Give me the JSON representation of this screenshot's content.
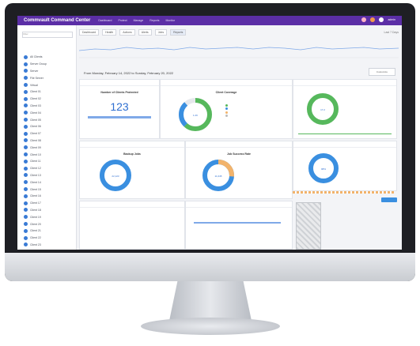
{
  "app": {
    "brand": "Commvault Command Center",
    "nav": [
      "Dashboard",
      "Protect",
      "Manage",
      "Reports",
      "Monitor"
    ],
    "user_label": "admin"
  },
  "sidebar": {
    "search_placeholder": "Filter",
    "items": [
      "All Clients",
      "Server Group",
      "Server",
      "File Server",
      "Virtual",
      "Client 01",
      "Client 02",
      "Client 03",
      "Client 04",
      "Client 05",
      "Client 06",
      "Client 07",
      "Client 08",
      "Client 09",
      "Client 10",
      "Client 11",
      "Client 12",
      "Client 13",
      "Client 14",
      "Client 15",
      "Client 16",
      "Client 17",
      "Client 18",
      "Client 19",
      "Client 20",
      "Client 21",
      "Client 22",
      "Client 23"
    ]
  },
  "toolbar": {
    "buttons": [
      "Dashboard",
      "Health",
      "Actions",
      "Alerts",
      "Jobs",
      "Reports"
    ],
    "active_index": 5,
    "right_label": "Last 7 Days"
  },
  "range": {
    "title": "From Monday, February 14, 2022 to Sunday, February 20, 2022",
    "button": "Customize"
  },
  "cards": {
    "count_card": {
      "title": "Number of Clients Protected",
      "value": "123"
    },
    "donut1": {
      "title": "Client Coverage",
      "center": "1.2K"
    },
    "donut_right1": {
      "center": "17.2"
    },
    "donut3": {
      "title": "Backup Jobs",
      "center": "22,123"
    },
    "donut4": {
      "title": "Job Success Rate",
      "center": "11,045"
    },
    "donut_right2": {
      "center": "98%"
    }
  },
  "colors": {
    "nav_bg": "#5b2ea6",
    "accent_blue": "#2f6fd1",
    "green": "#56b85c",
    "orange": "#f2b36b"
  }
}
